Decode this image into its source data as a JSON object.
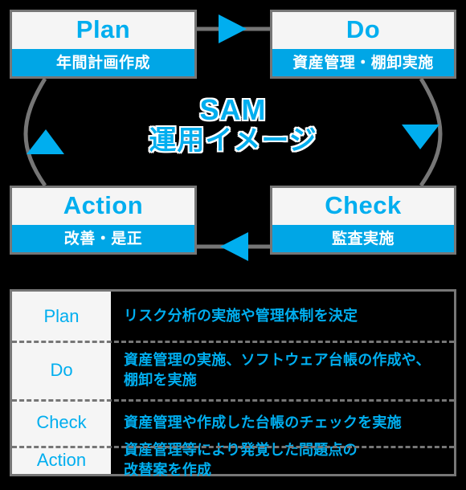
{
  "colors": {
    "accent_cyan": "#00AEEF",
    "band_cyan": "#00A6E6",
    "border_gray": "#767676",
    "box_fill": "#f5f5f5",
    "background": "#000000",
    "sub_text": "#ffffff"
  },
  "center_caption": {
    "line1": "SAM",
    "line2": "運用イメージ"
  },
  "cycle": {
    "boxes": [
      {
        "id": "plan",
        "title": "Plan",
        "subtitle": "年間計画作成"
      },
      {
        "id": "do",
        "title": "Do",
        "subtitle": "資産管理・棚卸実施"
      },
      {
        "id": "check",
        "title": "Check",
        "subtitle": "監査実施"
      },
      {
        "id": "action",
        "title": "Action",
        "subtitle": "改善・是正"
      }
    ],
    "arrows": [
      {
        "id": "plan-to-do",
        "direction": "right",
        "shape": "straight"
      },
      {
        "id": "do-to-check",
        "direction": "down",
        "shape": "arc"
      },
      {
        "id": "check-to-action",
        "direction": "left",
        "shape": "straight"
      },
      {
        "id": "action-to-plan",
        "direction": "up",
        "shape": "arc"
      }
    ]
  },
  "legend": {
    "rows": [
      {
        "label": "Plan",
        "lines": [
          "リスク分析の実施や管理体制を決定"
        ]
      },
      {
        "label": "Do",
        "lines": [
          "資産管理の実施、ソフトウェア台帳の作成や、",
          "棚卸を実施"
        ]
      },
      {
        "label": "Check",
        "lines": [
          "資産管理や作成した台帳のチェックを実施"
        ]
      },
      {
        "label": "Action",
        "lines": [
          "資産管理等により発覚した問題点の",
          "改替案を作成"
        ]
      }
    ]
  }
}
